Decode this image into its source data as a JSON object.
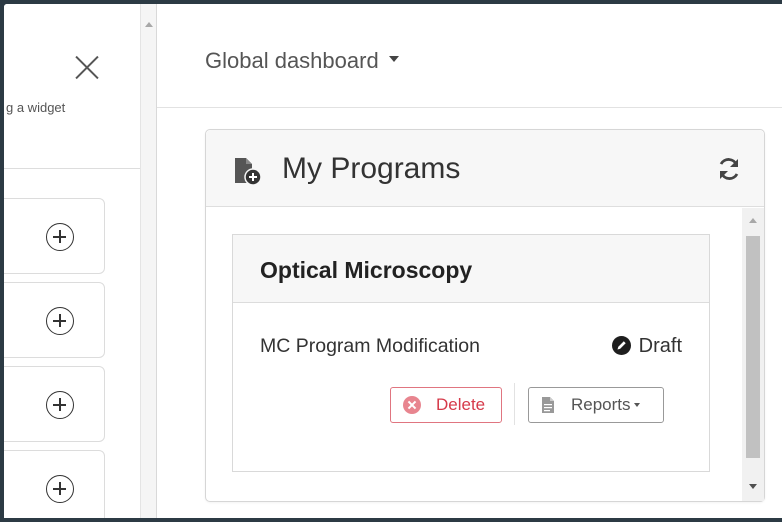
{
  "left_panel": {
    "hint_text": "g a widget",
    "add_buttons_count": 4
  },
  "header": {
    "dashboard_selector": "Global dashboard"
  },
  "widget": {
    "title": "My Programs",
    "icons": [
      "program-add-icon",
      "refresh-icon"
    ],
    "program_card": {
      "heading": "Optical Microscopy",
      "program_name": "MC Program Modification",
      "status": "Draft",
      "status_icon": "pencil-circle-icon",
      "delete_label": "Delete",
      "reports_label": "Reports"
    }
  },
  "colors": {
    "background_frame": "#2c3a44",
    "delete_red": "#d63a4a",
    "header_bg": "#f7f7f7"
  }
}
